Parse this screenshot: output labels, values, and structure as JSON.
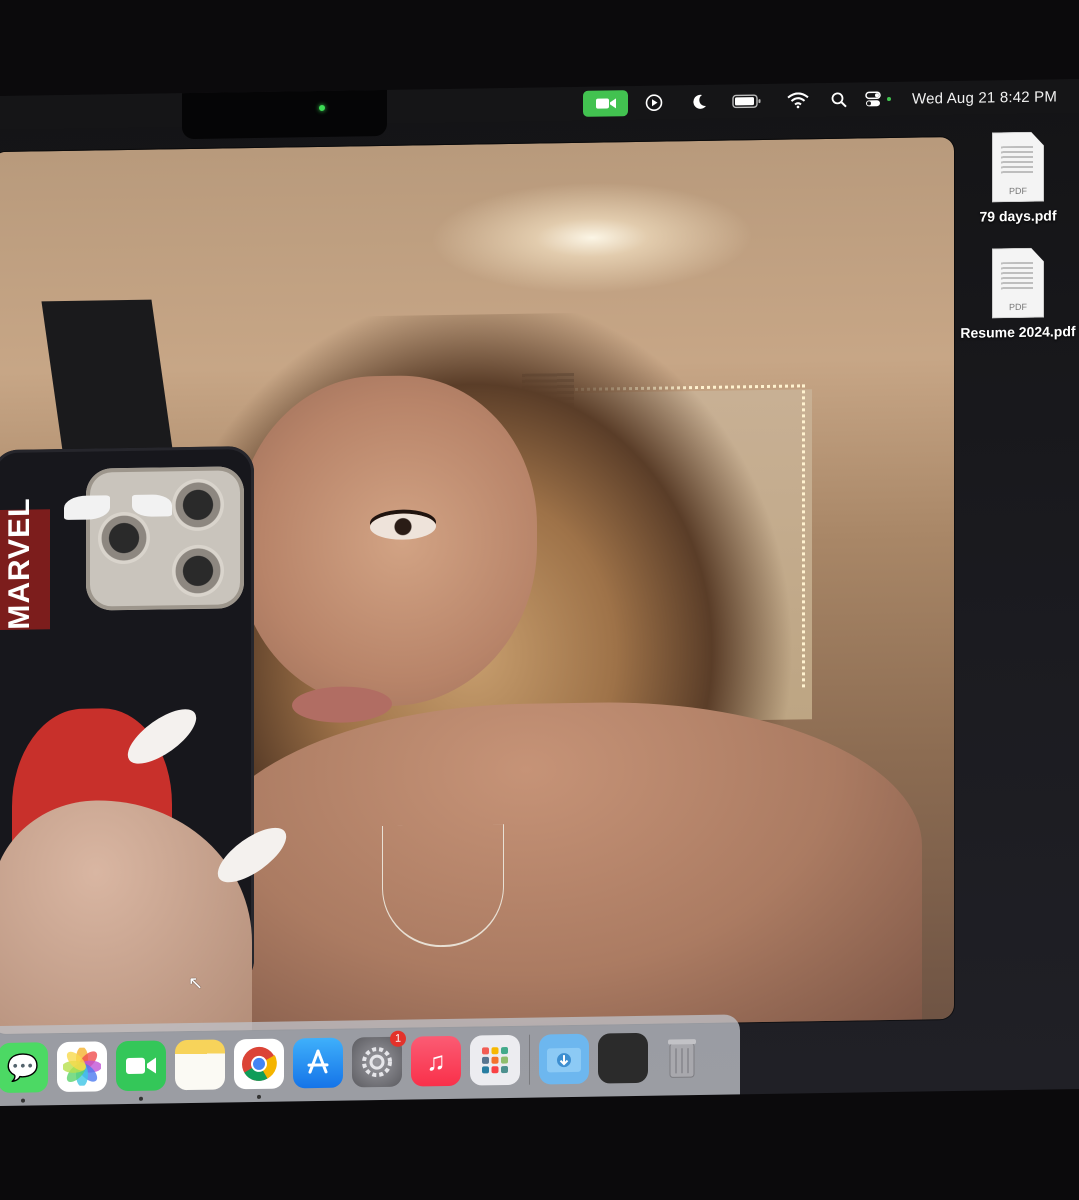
{
  "menubar": {
    "clock": "Wed Aug 21  8:42 PM",
    "icons": [
      "facetime-video-icon",
      "now-playing-icon",
      "focus-moon-icon",
      "battery-icon",
      "wifi-icon",
      "spotlight-search-icon",
      "control-center-icon"
    ]
  },
  "desktop": {
    "files": [
      {
        "name": "79 days.pdf",
        "badge": "PDF"
      },
      {
        "name": "Resume 2024.pdf",
        "badge": "PDF"
      }
    ]
  },
  "video": {
    "phone_sticker_text": "MARVEL"
  },
  "dock": {
    "apps": [
      {
        "name": "Messages",
        "icon": "messages-icon",
        "color": "#4cd964",
        "running": true
      },
      {
        "name": "Photos",
        "icon": "photos-icon",
        "color": "#ffffff",
        "running": false
      },
      {
        "name": "FaceTime",
        "icon": "facetime-icon",
        "color": "#34c759",
        "running": true
      },
      {
        "name": "Notes",
        "icon": "notes-icon",
        "color": "#f7d35a",
        "running": false
      },
      {
        "name": "Chrome",
        "icon": "chrome-icon",
        "color": "#ffffff",
        "running": true
      },
      {
        "name": "App Store",
        "icon": "app-store-icon",
        "color": "#1b8cf6",
        "running": false
      },
      {
        "name": "System Settings",
        "icon": "settings-gear-icon",
        "color": "#8e8e93",
        "running": false,
        "badge": "1"
      },
      {
        "name": "Music",
        "icon": "music-icon",
        "color": "#fa3c4c",
        "running": false
      },
      {
        "name": "Launchpad",
        "icon": "launchpad-icon",
        "color": "#e8e8ee",
        "running": false
      },
      {
        "name": "Downloads",
        "icon": "downloads-folder-icon",
        "color": "#5aa9e6",
        "running": false
      },
      {
        "name": "Screen Recording",
        "icon": "recent-window-icon",
        "color": "#2b2b2b",
        "running": false
      },
      {
        "name": "Trash",
        "icon": "trash-icon",
        "color": "#9a9a9a",
        "running": false
      }
    ]
  }
}
